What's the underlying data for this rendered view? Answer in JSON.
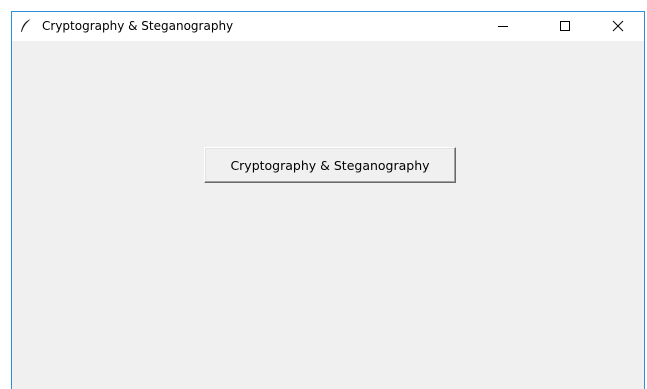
{
  "window": {
    "title": "Cryptography & Steganography",
    "controls": {
      "minimize_icon": "minimize-icon",
      "maximize_icon": "maximize-icon",
      "close_icon": "close-icon"
    },
    "app_icon": "feather-icon",
    "accent_color": "#2b90d9",
    "background_color": "#f0f0f0"
  },
  "main": {
    "button_label": "Cryptography & Steganography"
  }
}
